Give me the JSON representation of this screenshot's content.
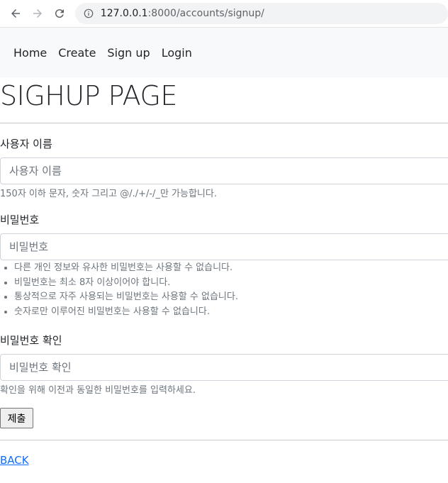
{
  "browser": {
    "url_host": "127.0.0.1",
    "url_rest": ":8000/accounts/signup/"
  },
  "navbar": {
    "items": [
      "Home",
      "Create",
      "Sign up",
      "Login"
    ]
  },
  "page": {
    "title": "SIGHUP PAGE"
  },
  "form": {
    "username": {
      "label": "사용자 이름",
      "placeholder": "사용자 이름",
      "help": "150자 이하 문자, 숫자 그리고 @/./+/-/_만 가능합니다."
    },
    "password1": {
      "label": "비밀번호",
      "placeholder": "비밀번호",
      "rules": [
        "다른 개인 정보와 유사한 비밀번호는 사용할 수 없습니다.",
        "비밀번호는 최소 8자 이상이어야 합니다.",
        "통상적으로 자주 사용되는 비밀번호는 사용할 수 없습니다.",
        "숫자로만 이루어진 비밀번호는 사용할 수 없습니다."
      ]
    },
    "password2": {
      "label": "비밀번호 확인",
      "placeholder": "비밀번호 확인",
      "help": "확인을 위해 이전과 동일한 비밀번호를 입력하세요."
    },
    "submit_label": "제출"
  },
  "back_link": "BACK"
}
